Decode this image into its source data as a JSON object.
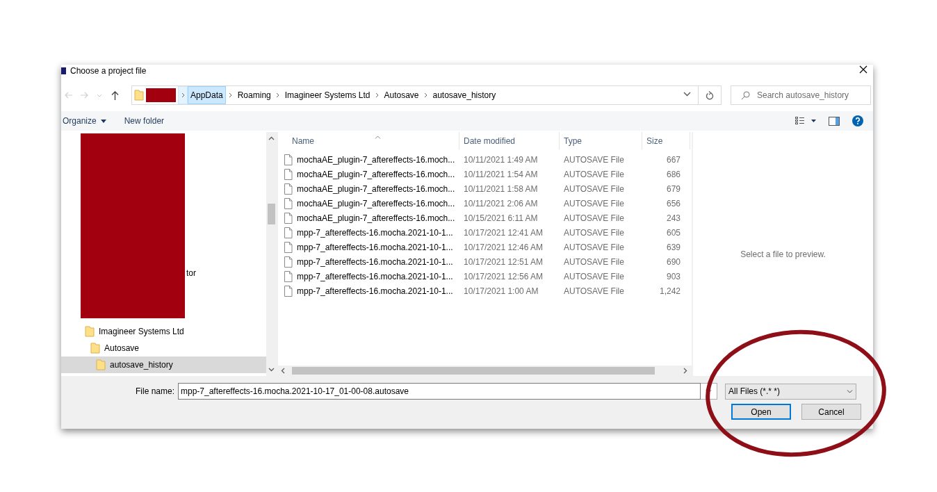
{
  "window": {
    "title": "Choose a project file"
  },
  "navigation": {
    "back_disabled": true,
    "forward_disabled": true
  },
  "breadcrumb": [
    {
      "redacted": true
    },
    {
      "label": "AppData",
      "redacted": false,
      "hovered": true
    },
    {
      "label": "Roaming",
      "redacted": false,
      "hovered": false
    },
    {
      "label": "Imagineer Systems Ltd",
      "redacted": false,
      "hovered": false
    },
    {
      "label": "Autosave",
      "redacted": false,
      "hovered": false
    },
    {
      "label": "autosave_history",
      "redacted": false,
      "hovered": false
    }
  ],
  "search": {
    "placeholder": "Search autosave_history"
  },
  "toolbar": {
    "buttons": [
      "Organize",
      "New folder"
    ]
  },
  "nav_tree": {
    "redacted_area": true,
    "items": [
      {
        "label": "tor",
        "selected": false
      },
      {
        "label": "Imagineer Systems Ltd",
        "selected": false,
        "children": [
          {
            "label": "Autosave",
            "selected": false,
            "children": [
              {
                "label": "autosave_history",
                "selected": true
              }
            ]
          }
        ]
      }
    ]
  },
  "table": {
    "columns": [
      {
        "label": "Name",
        "sorted": true
      },
      {
        "label": "Date modified",
        "sorted": false
      },
      {
        "label": "Type",
        "sorted": false
      },
      {
        "label": "Size",
        "sorted": false
      }
    ],
    "rows": [
      [
        "mochaAE_plugin-7_aftereffects-16.moch...",
        "10/11/2021 1:49 AM",
        "AUTOSAVE File",
        "667"
      ],
      [
        "mochaAE_plugin-7_aftereffects-16.moch...",
        "10/11/2021 1:54 AM",
        "AUTOSAVE File",
        "686"
      ],
      [
        "mochaAE_plugin-7_aftereffects-16.moch...",
        "10/11/2021 1:58 AM",
        "AUTOSAVE File",
        "679"
      ],
      [
        "mochaAE_plugin-7_aftereffects-16.moch...",
        "10/11/2021 2:06 AM",
        "AUTOSAVE File",
        "656"
      ],
      [
        "mochaAE_plugin-7_aftereffects-16.moch...",
        "10/15/2021 6:11 AM",
        "AUTOSAVE File",
        "243"
      ],
      [
        "mpp-7_aftereffects-16.mocha.2021-10-1...",
        "10/17/2021 12:41 AM",
        "AUTOSAVE File",
        "605"
      ],
      [
        "mpp-7_aftereffects-16.mocha.2021-10-1...",
        "10/17/2021 12:46 AM",
        "AUTOSAVE File",
        "639"
      ],
      [
        "mpp-7_aftereffects-16.mocha.2021-10-1...",
        "10/17/2021 12:51 AM",
        "AUTOSAVE File",
        "690"
      ],
      [
        "mpp-7_aftereffects-16.mocha.2021-10-1...",
        "10/17/2021 12:56 AM",
        "AUTOSAVE File",
        "903"
      ],
      [
        "mpp-7_aftereffects-16.mocha.2021-10-1...",
        "10/17/2021 1:00 AM",
        "AUTOSAVE File",
        "1,242"
      ]
    ]
  },
  "preview": {
    "message": "Select a file to preview."
  },
  "file_name": {
    "label": "File name:",
    "value": "mpp-7_aftereffects-16.mocha.2021-10-17_01-00-08.autosave"
  },
  "file_type": {
    "value": "All Files (*.* *)"
  },
  "buttons": [
    {
      "label": "Open",
      "default": true
    },
    {
      "label": "Cancel",
      "default": false
    }
  ],
  "annotations": [
    {
      "kind": "ellipse",
      "color": "#8e0f18"
    }
  ]
}
